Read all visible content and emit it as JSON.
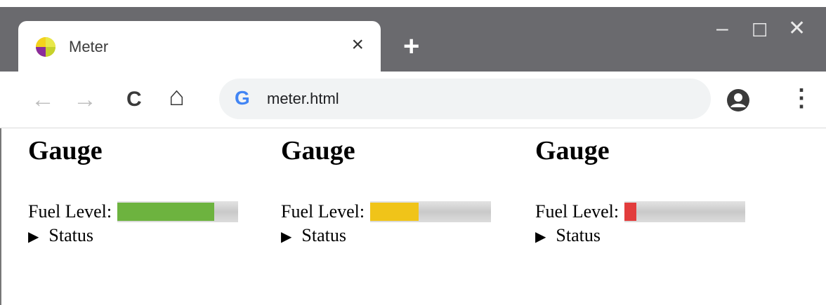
{
  "browser": {
    "tab_title": "Meter",
    "tab_close": "×",
    "new_tab": "+",
    "window": {
      "minimize": "–",
      "maximize": "☐",
      "close": "✕"
    },
    "nav": {
      "back": "←",
      "forward": "→",
      "reload": "C",
      "home": "⌂"
    },
    "url": "meter.html",
    "search_icon": "G",
    "menu": "⋮"
  },
  "colors": {
    "green": "#6db33f",
    "yellow": "#f0c419",
    "red": "#e23c3c"
  },
  "gauges": [
    {
      "title": "Gauge",
      "label": "Fuel Level:",
      "value": 0.8,
      "status": "Status",
      "color": "#6db33f"
    },
    {
      "title": "Gauge",
      "label": "Fuel Level:",
      "value": 0.4,
      "status": "Status",
      "color": "#f0c419"
    },
    {
      "title": "Gauge",
      "label": "Fuel Level:",
      "value": 0.1,
      "status": "Status",
      "color": "#e23c3c"
    }
  ]
}
